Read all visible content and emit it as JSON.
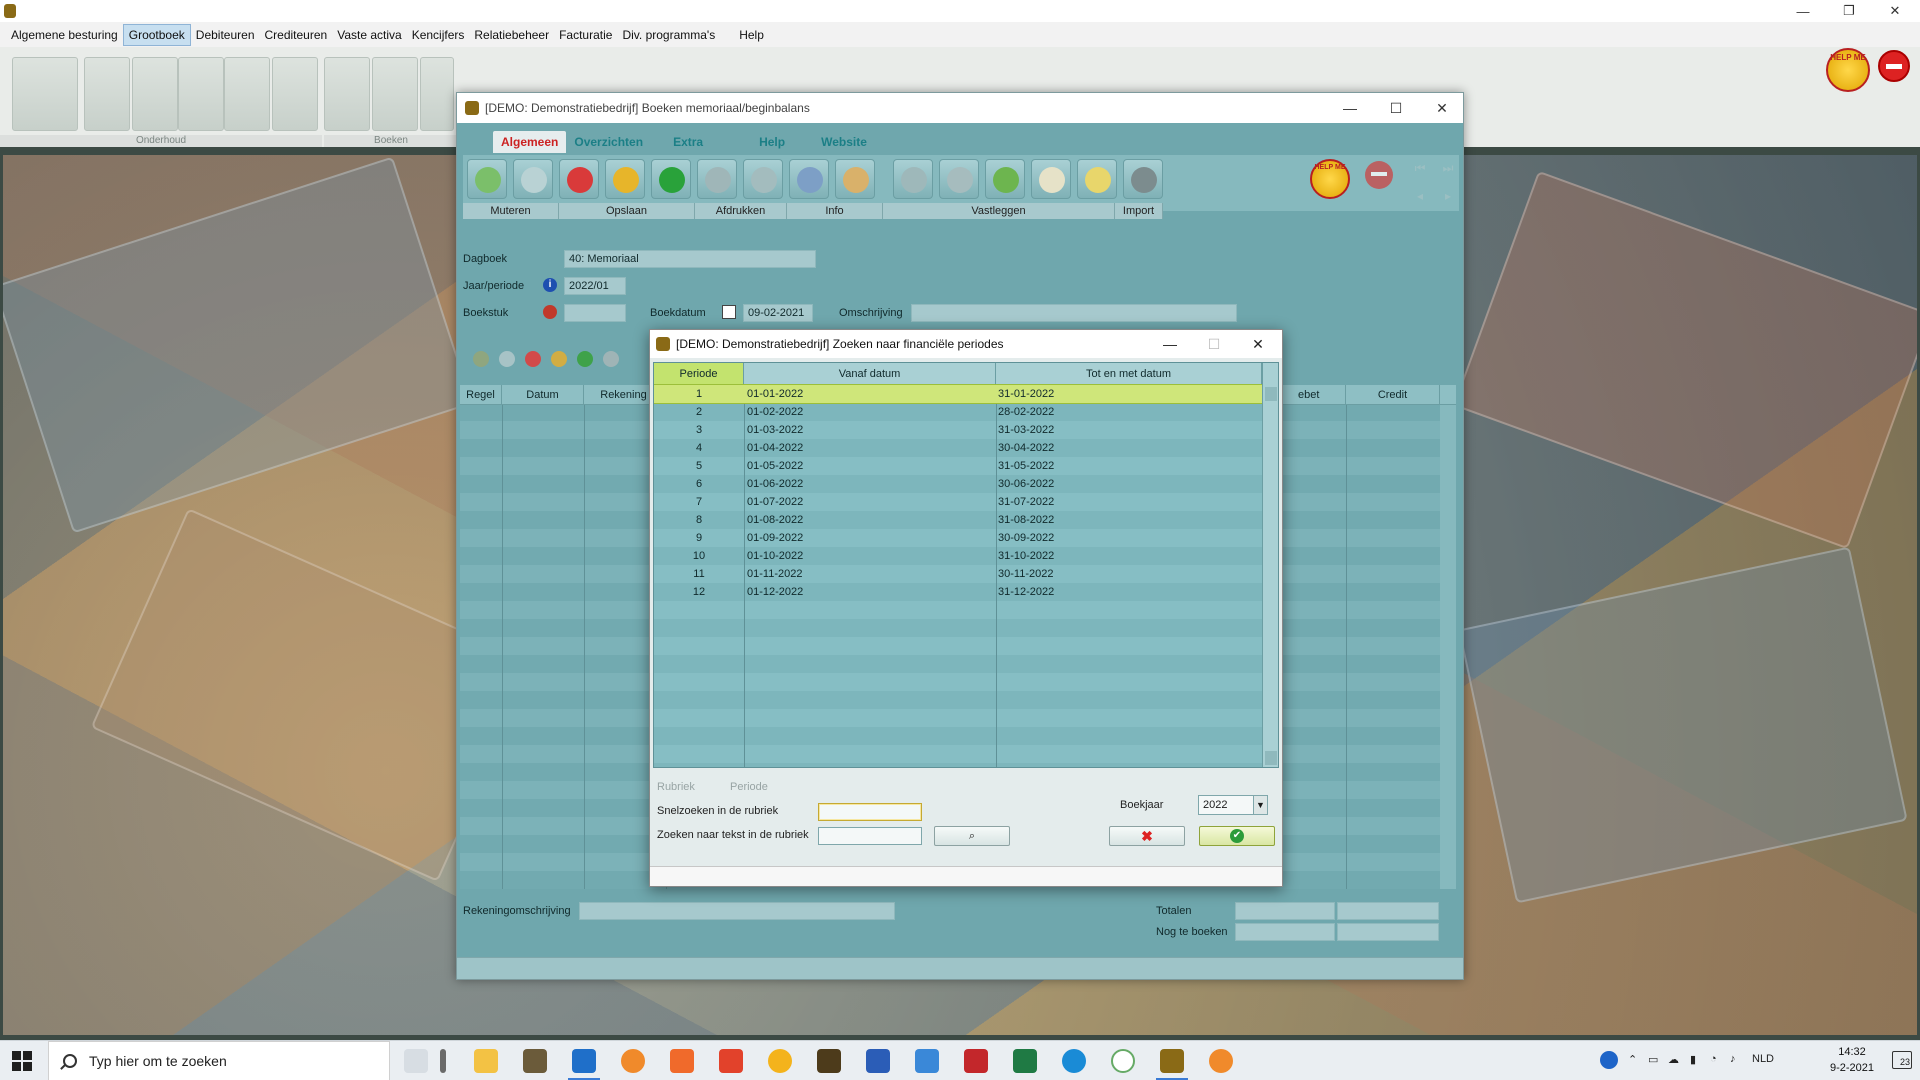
{
  "app": {
    "menu": [
      "Algemene besturing",
      "Grootboek",
      "Debiteuren",
      "Crediteuren",
      "Vaste activa",
      "Kencijfers",
      "Relatiebeheer",
      "Facturatie",
      "Div. programma's",
      "Help"
    ],
    "active_menu": "Grootboek",
    "toolbar_groups": [
      "Onderhoud",
      "Boeken"
    ],
    "helpme_label": "HELP ME",
    "window_controls": {
      "minimize": "—",
      "restore": "❐",
      "close": "✕"
    }
  },
  "memoriaal": {
    "title": "[DEMO: Demonstratiebedrijf]  Boeken memoriaal/beginbalans",
    "tabs": [
      "Algemeen",
      "Overzichten",
      "Extra",
      "Help",
      "Website"
    ],
    "active_tab": "Algemeen",
    "toolbar_groups": [
      "Muteren",
      "Opslaan",
      "Afdrukken",
      "Info",
      "Vastleggen",
      "Import"
    ],
    "helpme_label": "HELP ME",
    "fields": {
      "dagboek_label": "Dagboek",
      "dagboek_value": "40: Memoriaal",
      "jaar_periode_label": "Jaar/periode",
      "jaar_periode_value": "2022/01",
      "boekstuk_label": "Boekstuk",
      "boekdatum_label": "Boekdatum",
      "boekdatum_value": "09-02-2021",
      "omschrijving_label": "Omschrijving"
    },
    "grid_columns": [
      "Regel",
      "Datum",
      "Rekening",
      "ebet",
      "Credit"
    ],
    "footer": {
      "rekeningomschrijving_label": "Rekeningomschrijving",
      "totalen_label": "Totalen",
      "nog_te_boeken_label": "Nog te boeken"
    }
  },
  "dialog": {
    "title": "[DEMO: Demonstratiebedrijf]  Zoeken naar financiële periodes",
    "columns": [
      "Periode",
      "Vanaf datum",
      "Tot en met datum"
    ],
    "rows": [
      {
        "periode": "1",
        "vanaf": "01-01-2022",
        "tot": "31-01-2022"
      },
      {
        "periode": "2",
        "vanaf": "01-02-2022",
        "tot": "28-02-2022"
      },
      {
        "periode": "3",
        "vanaf": "01-03-2022",
        "tot": "31-03-2022"
      },
      {
        "periode": "4",
        "vanaf": "01-04-2022",
        "tot": "30-04-2022"
      },
      {
        "periode": "5",
        "vanaf": "01-05-2022",
        "tot": "31-05-2022"
      },
      {
        "periode": "6",
        "vanaf": "01-06-2022",
        "tot": "30-06-2022"
      },
      {
        "periode": "7",
        "vanaf": "01-07-2022",
        "tot": "31-07-2022"
      },
      {
        "periode": "8",
        "vanaf": "01-08-2022",
        "tot": "31-08-2022"
      },
      {
        "periode": "9",
        "vanaf": "01-09-2022",
        "tot": "30-09-2022"
      },
      {
        "periode": "10",
        "vanaf": "01-10-2022",
        "tot": "31-10-2022"
      },
      {
        "periode": "11",
        "vanaf": "01-11-2022",
        "tot": "30-11-2022"
      },
      {
        "periode": "12",
        "vanaf": "01-12-2022",
        "tot": "31-12-2022"
      }
    ],
    "selected_row": 1,
    "rubriek_label": "Rubriek",
    "rubriek_value": "Periode",
    "snelzoeken_label": "Snelzoeken in de rubriek",
    "zoeken_tekst_label": "Zoeken naar tekst in de rubriek",
    "boekjaar_label": "Boekjaar",
    "boekjaar_value": "2022",
    "cancel_icon": "red-x-icon",
    "ok_icon": "green-check-icon"
  },
  "taskbar": {
    "search_placeholder": "Typ hier om te zoeken",
    "language": "NLD",
    "time": "14:32",
    "date": "9-2-2021",
    "notifications": "23"
  },
  "colors": {
    "teal": "#6fa7ad",
    "selected_row": "#cfe67a",
    "active_tab": "#cc2222"
  }
}
